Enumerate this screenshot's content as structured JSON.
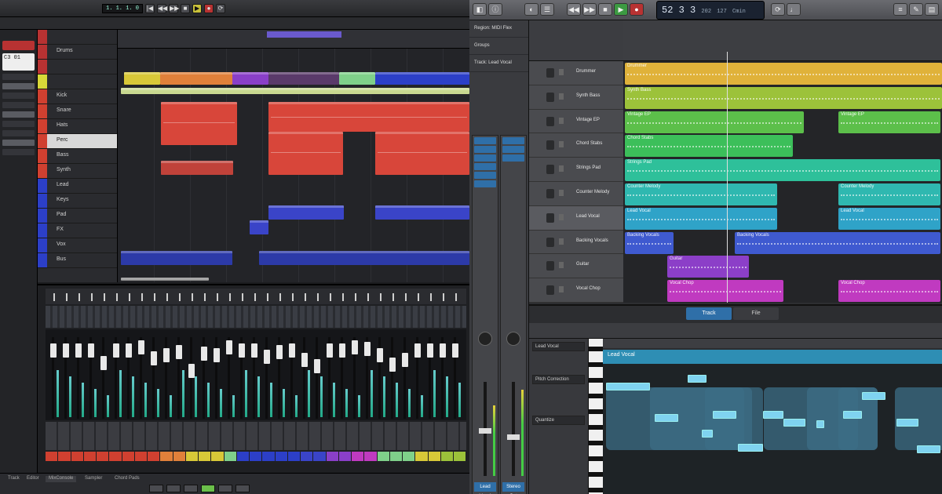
{
  "left_daw": {
    "toolbar": {
      "position_display": "1. 1. 1. 0",
      "buttons": [
        "|◀",
        "◀◀",
        "▶▶",
        "■",
        "▶",
        "●",
        "⟳"
      ]
    },
    "inspector": {
      "display_text": "C3 01"
    },
    "tracks": [
      {
        "name": "",
        "color": "#b83232"
      },
      {
        "name": "Drums",
        "color": "#b83232"
      },
      {
        "name": "",
        "color": "#b83232"
      },
      {
        "name": "",
        "color": "#d8d838"
      },
      {
        "name": "Kick",
        "color": "#d04030"
      },
      {
        "name": "Snare",
        "color": "#d04030"
      },
      {
        "name": "Hats",
        "color": "#d04030"
      },
      {
        "name": "Perc",
        "color": "#d04030"
      },
      {
        "name": "Bass",
        "color": "#d04030"
      },
      {
        "name": "Synth",
        "color": "#d04030"
      },
      {
        "name": "Lead",
        "color": "#2c3fc8"
      },
      {
        "name": "Keys",
        "color": "#2c3fc8"
      },
      {
        "name": "Pad",
        "color": "#2c3fc8"
      },
      {
        "name": "FX",
        "color": "#2c3fc8"
      },
      {
        "name": "Vox",
        "color": "#2c3fc8"
      },
      {
        "name": "Bus",
        "color": "#2c3fc8"
      }
    ],
    "status_tabs": [
      "Track",
      "Editor",
      "MixConsole",
      "Sampler",
      "Chord Pads"
    ]
  },
  "right_daw": {
    "lcd": {
      "bar": "52",
      "beat": "3",
      "sub": "3",
      "tick": "202",
      "bpm": "127",
      "key": "Cmin"
    },
    "sidebar": [
      "Region: MIDI Flex",
      "Groups",
      "Track: Lead Vocal"
    ],
    "channel_strips": [
      {
        "label": "Lead Vocal",
        "color": "#2f6fa8"
      },
      {
        "label": "Stereo Out",
        "color": "#2f6fa8"
      }
    ],
    "tracks": [
      {
        "name": "Drummer",
        "color": "#e0b23a"
      },
      {
        "name": "Synth Bass",
        "color": "#9cc23a"
      },
      {
        "name": "Vintage EP",
        "color": "#5cbf4a"
      },
      {
        "name": "Chord Stabs",
        "color": "#3cbf5a"
      },
      {
        "name": "Strings Pad",
        "color": "#2ec09a"
      },
      {
        "name": "Counter Melody",
        "color": "#2fb8b0"
      },
      {
        "name": "Lead Vocal",
        "color": "#2fa3c8"
      },
      {
        "name": "Backing Vocals",
        "color": "#3f5ad0"
      },
      {
        "name": "Guitar",
        "color": "#8c3fc8"
      },
      {
        "name": "Vocal Chop",
        "color": "#c03ac0"
      }
    ],
    "editor": {
      "tabs": [
        "Track",
        "File"
      ],
      "region_name": "Lead Vocal",
      "inspector": [
        "Lead Vocal",
        "Pitch Correction",
        "Quantize"
      ]
    }
  }
}
